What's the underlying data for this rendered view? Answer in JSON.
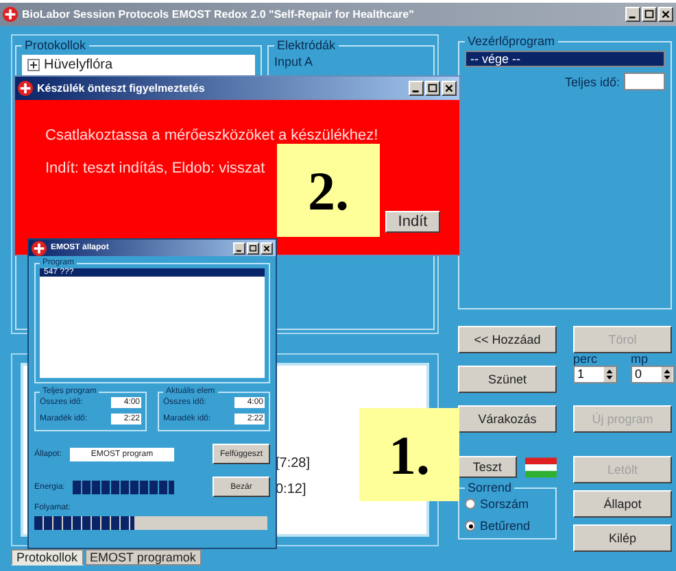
{
  "main_window": {
    "title": "BioLabor Session Protocols EMOST Redox 2.0 \"Self-Repair for Healthcare\"",
    "protocols": {
      "title": "Protokollok",
      "items": [
        {
          "label": "Hüvelyflóra",
          "expanded": false
        }
      ]
    },
    "electrodes": {
      "title": "Elektródák",
      "items": [
        "Input A"
      ]
    },
    "log_lines": [
      "[7:28]",
      "0:12]"
    ],
    "tabs": [
      {
        "label": "Protokollok",
        "selected": true
      },
      {
        "label": "EMOST programok",
        "selected": false
      }
    ],
    "control_program": {
      "title": "Vezérlőprogram",
      "items": [
        {
          "label": "-- vége --",
          "selected": true
        }
      ],
      "total_time_label": "Teljes idő:"
    },
    "buttons": [
      {
        "label": "<< Hozzáad",
        "disabled": false
      },
      {
        "label": "Törol",
        "disabled": true
      },
      {
        "label": "Szünet",
        "disabled": false
      },
      {
        "label": "Várakozás",
        "disabled": false
      },
      {
        "label": "Új program",
        "disabled": true
      },
      {
        "label": "Teszt",
        "disabled": false
      },
      {
        "label": "Letölt",
        "disabled": true
      },
      {
        "label": "Állapot",
        "disabled": false
      },
      {
        "label": "Kilép",
        "disabled": false
      }
    ],
    "spinners": [
      {
        "label": "perc",
        "value": "1"
      },
      {
        "label": "mp",
        "value": "0"
      }
    ],
    "order": {
      "title": "Sorrend",
      "options": [
        {
          "label": "Sorszám",
          "selected": false
        },
        {
          "label": "Betűrend",
          "selected": true
        }
      ]
    }
  },
  "warning_dialog": {
    "title": "Készülék önteszt figyelmeztetés",
    "lines": [
      "Csatlakoztassa a mérőeszközöket a készülékhez!",
      "Indít: teszt indítás, Eldob: visszat"
    ],
    "button": "Indít"
  },
  "status_window": {
    "title": "EMOST állapot",
    "program": {
      "title": "Program",
      "items": [
        {
          "label": "547 ???",
          "selected": true
        }
      ]
    },
    "groups": [
      {
        "title": "Teljes program",
        "rows": [
          {
            "label": "Összes idő:",
            "value": "4:00"
          },
          {
            "label": "Maradék idő:",
            "value": "2:22"
          }
        ]
      },
      {
        "title": "Aktuális elem",
        "rows": [
          {
            "label": "Összes idő:",
            "value": "4:00"
          },
          {
            "label": "Maradék idő:",
            "value": "2:22"
          }
        ]
      }
    ],
    "state_label": "Állapot:",
    "state_value": "EMOST program",
    "pause_button": "Felfüggeszt",
    "close_button": "Bezár",
    "energy": {
      "label": "Energia:",
      "level": 1
    },
    "progress": {
      "label": "Folyamat:",
      "level": 0.43
    }
  },
  "callouts": [
    "1.",
    "2."
  ]
}
